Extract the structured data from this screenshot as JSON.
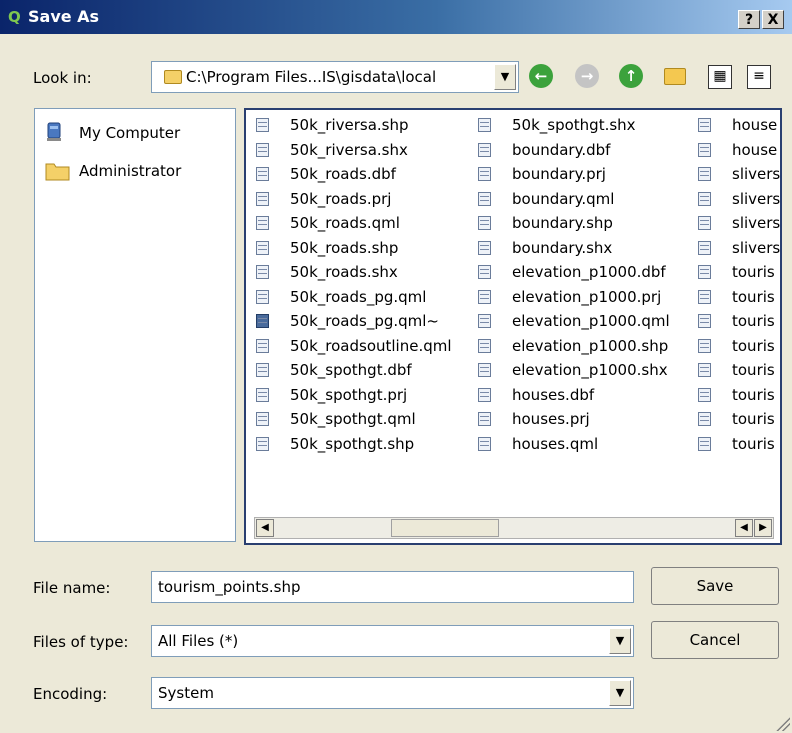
{
  "window": {
    "title": "Save As",
    "help_label": "?",
    "close_label": "X",
    "app_icon_glyph": "Q"
  },
  "look_in": {
    "label": "Look in:",
    "path": "C:\\Program Files...IS\\gisdata\\local"
  },
  "toolbar": {
    "back_icon": "back-arrow-icon",
    "forward_icon": "forward-arrow-icon",
    "up_icon": "parent-folder-icon",
    "new_folder_icon": "new-folder-icon",
    "list_view_icon": "list-view-icon",
    "detail_view_icon": "detail-view-icon"
  },
  "sidebar": {
    "items": [
      {
        "label": "My Computer",
        "icon": "computer-icon"
      },
      {
        "label": "Administrator",
        "icon": "folder-icon"
      }
    ]
  },
  "files": {
    "col1": [
      "50k_riversa.shp",
      "50k_riversa.shx",
      "50k_roads.dbf",
      "50k_roads.prj",
      "50k_roads.qml",
      "50k_roads.shp",
      "50k_roads.shx",
      "50k_roads_pg.qml",
      "50k_roads_pg.qml~",
      "50k_roadsoutline.qml",
      "50k_spothgt.dbf",
      "50k_spothgt.prj",
      "50k_spothgt.qml",
      "50k_spothgt.shp"
    ],
    "col2": [
      "50k_spothgt.shx",
      "boundary.dbf",
      "boundary.prj",
      "boundary.qml",
      "boundary.shp",
      "boundary.shx",
      "elevation_p1000.dbf",
      "elevation_p1000.prj",
      "elevation_p1000.qml",
      "elevation_p1000.shp",
      "elevation_p1000.shx",
      "houses.dbf",
      "houses.prj",
      "houses.qml"
    ],
    "col3": [
      "house",
      "house",
      "slivers",
      "slivers",
      "slivers",
      "slivers",
      "touris",
      "touris",
      "touris",
      "touris",
      "touris",
      "touris",
      "touris",
      "touris"
    ]
  },
  "form": {
    "file_name_label": "File name:",
    "file_name_value": "tourism_points.shp",
    "files_of_type_label": "Files of type:",
    "files_of_type_value": "All Files (*)",
    "encoding_label": "Encoding:",
    "encoding_value": "System"
  },
  "buttons": {
    "save": "Save",
    "cancel": "Cancel"
  },
  "colors": {
    "title_start": "#0a246a",
    "title_end": "#a6caf0",
    "dialog_bg": "#ece9d8",
    "list_border": "#2a3f70"
  }
}
